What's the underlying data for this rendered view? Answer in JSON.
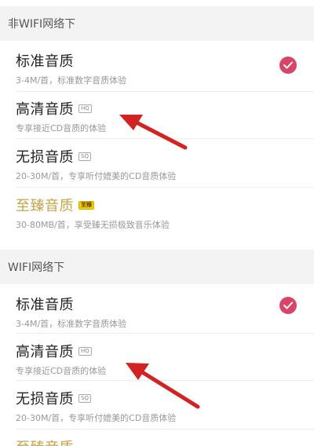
{
  "sections": [
    {
      "header": "非WIFI网络下",
      "options": [
        {
          "title": "标准音质",
          "badge": "",
          "desc": "3-4M/首，标准数字音质体验",
          "selected": true
        },
        {
          "title": "高清音质",
          "badge": "HQ",
          "desc": "专享接近CD音质的体验",
          "selected": false
        },
        {
          "title": "无损音质",
          "badge": "SQ",
          "desc": "20-30M/首，专享听付媲美的CD音质体验",
          "selected": false
        },
        {
          "title": "至臻音质",
          "badge": "至臻",
          "desc": "30-80MB/首，享受臻无损极致音乐体验",
          "selected": false
        }
      ]
    },
    {
      "header": "WIFI网络下",
      "options": [
        {
          "title": "标准音质",
          "badge": "",
          "desc": "3-4M/首，标准数字音质体验",
          "selected": true
        },
        {
          "title": "高清音质",
          "badge": "HQ",
          "desc": "专享接近CD音质的体验",
          "selected": false
        },
        {
          "title": "无损音质",
          "badge": "SQ",
          "desc": "20-30M/首，专享听付媲美的CD音质体验",
          "selected": false
        },
        {
          "title": "至臻音质",
          "badge": "",
          "desc": "",
          "selected": false
        }
      ]
    }
  ],
  "colors": {
    "accent": "#d9456a",
    "arrow": "#d32222",
    "gold_title": "#c4a44a",
    "header_bg": "#f3f3f3"
  }
}
